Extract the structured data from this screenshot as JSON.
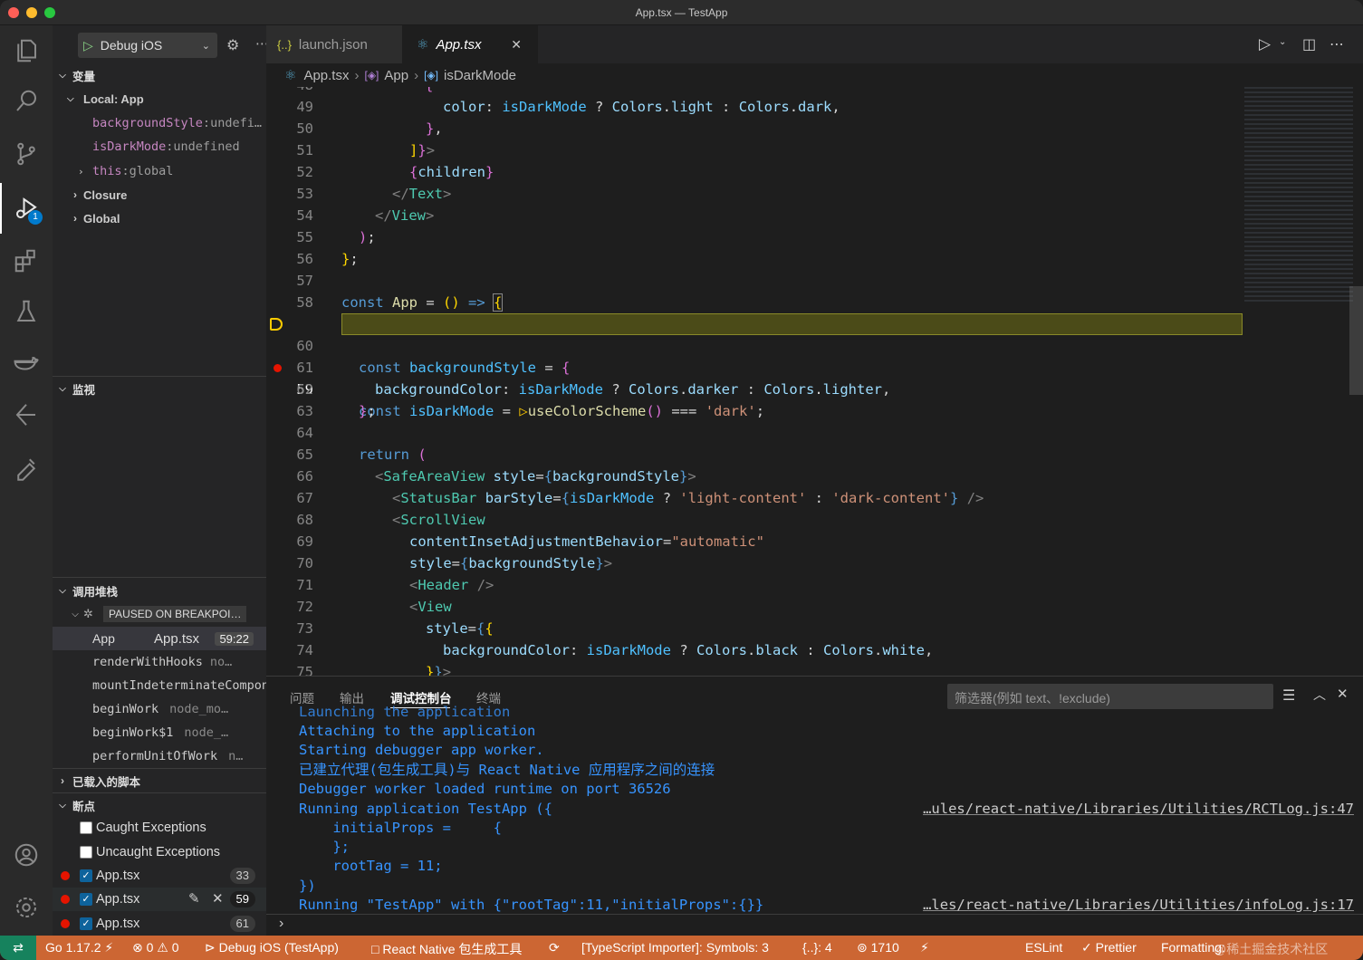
{
  "window": {
    "title": "App.tsx — TestApp"
  },
  "colors": {
    "statusbar": "#cc6633",
    "breakpoint": "#e51400",
    "accent": "#007acc"
  },
  "sidebar": {
    "debug_config": "Debug iOS",
    "variables_header": "变量",
    "local_header": "Local: App",
    "local_vars": [
      {
        "name": "backgroundStyle",
        "value": "undefi…"
      },
      {
        "name": "isDarkMode",
        "value": "undefined"
      },
      {
        "name": "this",
        "value": "global"
      }
    ],
    "closure": "Closure",
    "global": "Global",
    "watch_header": "监视",
    "callstack_header": "调用堆栈",
    "paused_label": "PAUSED ON BREAKPOI…",
    "frames": [
      {
        "fn": "App",
        "file": "App.tsx",
        "pos": "59:22"
      },
      {
        "fn": "renderWithHooks",
        "file": "no…"
      },
      {
        "fn": "mountIndeterminateCompon",
        "file": ""
      },
      {
        "fn": "beginWork",
        "file": "node_mo…"
      },
      {
        "fn": "beginWork$1",
        "file": "node_…"
      },
      {
        "fn": "performUnitOfWork",
        "file": "n…"
      }
    ],
    "loaded_scripts": "已载入的脚本",
    "breakpoints_header": "断点",
    "bp_caught": "Caught Exceptions",
    "bp_uncaught": "Uncaught Exceptions",
    "breakpoints": [
      {
        "file": "App.tsx",
        "line": "33"
      },
      {
        "file": "App.tsx",
        "line": "59"
      },
      {
        "file": "App.tsx",
        "line": "61"
      }
    ]
  },
  "tabs": [
    {
      "label": "launch.json"
    },
    {
      "label": "App.tsx"
    }
  ],
  "breadcrumb": {
    "file": "App.tsx",
    "symbol1": "App",
    "symbol2": "isDarkMode"
  },
  "code": {
    "lines": [
      "49",
      "50",
      "51",
      "52",
      "53",
      "54",
      "55",
      "56",
      "57",
      "58",
      "59",
      "60",
      "61",
      "62",
      "63",
      "64",
      "65",
      "66",
      "67",
      "68",
      "69",
      "70",
      "71",
      "72",
      "73",
      "74"
    ],
    "top_partial": "48",
    "bottom_partial": "75"
  },
  "panel": {
    "tabs": [
      "问题",
      "输出",
      "调试控制台",
      "终端"
    ],
    "filter_placeholder": "筛选器(例如 text、!exclude)",
    "console": [
      "Launching the application",
      "Attaching to the application",
      "Starting debugger app worker.",
      "已建立代理(包生成工具)与 React Native 应用程序之间的连接",
      "Debugger worker loaded runtime on port 36526",
      "Running application TestApp ({",
      "    initialProps =     {",
      "    };",
      "    rootTag = 11;",
      "})",
      "Running \"TestApp\" with {\"rootTag\":11,\"initialProps\":{}}"
    ],
    "source1": "…ules/react-native/Libraries/Utilities/RCTLog.js:47",
    "source2": "…les/react-native/Libraries/Utilities/infoLog.js:17"
  },
  "status": {
    "go": "Go 1.17.2",
    "errors": "0",
    "warnings": "0",
    "debug": "Debug iOS (TestApp)",
    "rn": "React Native 包生成工具",
    "ts": "[TypeScript Importer]: Symbols: 3",
    "braces": "{..}: 4",
    "port": "1710",
    "eslint": "ESLint",
    "prettier": "Prettier",
    "formatting": "Formatting:",
    "watermark": "@稀土掘金技术社区"
  }
}
